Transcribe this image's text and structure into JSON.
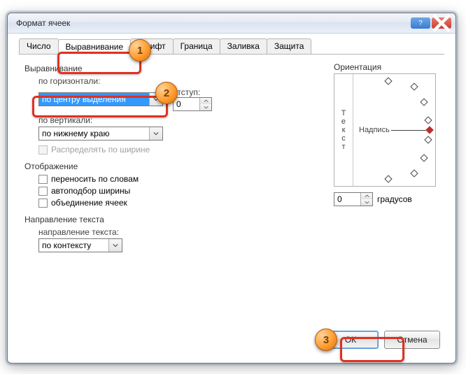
{
  "window": {
    "title": "Формат ячеек"
  },
  "tabs": [
    "Число",
    "Выравнивание",
    "Шрифт",
    "Граница",
    "Заливка",
    "Защита"
  ],
  "active_tab_index": 1,
  "alignment": {
    "group": "Выравнивание",
    "h_label": "по горизонтали:",
    "h_value": "по центру выделения",
    "v_label": "по вертикали:",
    "v_value": "по нижнему краю",
    "indent_label": "отступ:",
    "indent_value": "0",
    "justify_label": "Распределять по ширине"
  },
  "display": {
    "group": "Отображение",
    "wrap": "переносить по словам",
    "shrink": "автоподбор ширины",
    "merge": "объединение ячеек"
  },
  "direction": {
    "group": "Направление текста",
    "label": "направление текста:",
    "value": "по контексту"
  },
  "orientation": {
    "group": "Ориентация",
    "vtext": "Текст",
    "hlabel": "Надпись",
    "degrees": "0",
    "deg_label": "градусов"
  },
  "buttons": {
    "ok": "ОК",
    "cancel": "Отмена"
  },
  "callouts": {
    "c1": "1",
    "c2": "2",
    "c3": "3"
  }
}
